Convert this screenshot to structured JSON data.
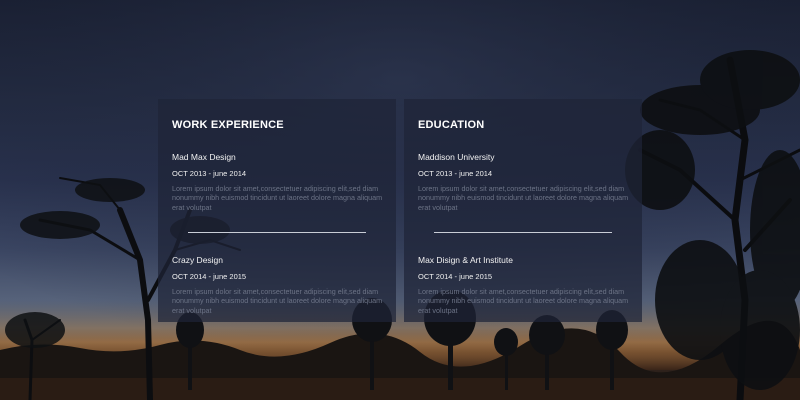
{
  "work": {
    "title": "WORK EXPERIENCE",
    "entries": [
      {
        "name": "Mad Max Design",
        "period": "OCT 2013 - june 2014",
        "description": "Lorem ipsum dolor sit amet,consectetuer adipiscing elit,sed diam nonummy nibh euismod tincidunt ut laoreet dolore magna aliquam erat volutpat"
      },
      {
        "name": "Crazy Design",
        "period": "OCT 2014 - june 2015",
        "description": "Lorem ipsum dolor sit amet,consectetuer adipiscing elit,sed diam nonummy nibh euismod tincidunt ut laoreet dolore magna aliquam erat volutpat"
      }
    ]
  },
  "education": {
    "title": "EDUCATION",
    "entries": [
      {
        "name": "Maddison University",
        "period": "OCT 2013 - june 2014",
        "description": "Lorem ipsum dolor sit amet,consectetuer adipiscing elit,sed diam nonummy nibh euismod tincidunt ut laoreet dolore magna aliquam erat volutpat"
      },
      {
        "name": "Max Disign & Art Institute",
        "period": "OCT 2014 - june 2015",
        "description": "Lorem ipsum dolor sit amet,consectetuer adipiscing elit,sed diam nonummy nibh euismod tincidunt ut laoreet dolore magna aliquam erat volutpat"
      }
    ]
  },
  "colors": {
    "panel_bg": "#1e2438",
    "heading": "#ffffff",
    "muted_text": "#6c7386",
    "divider": "#c9cdd6"
  }
}
